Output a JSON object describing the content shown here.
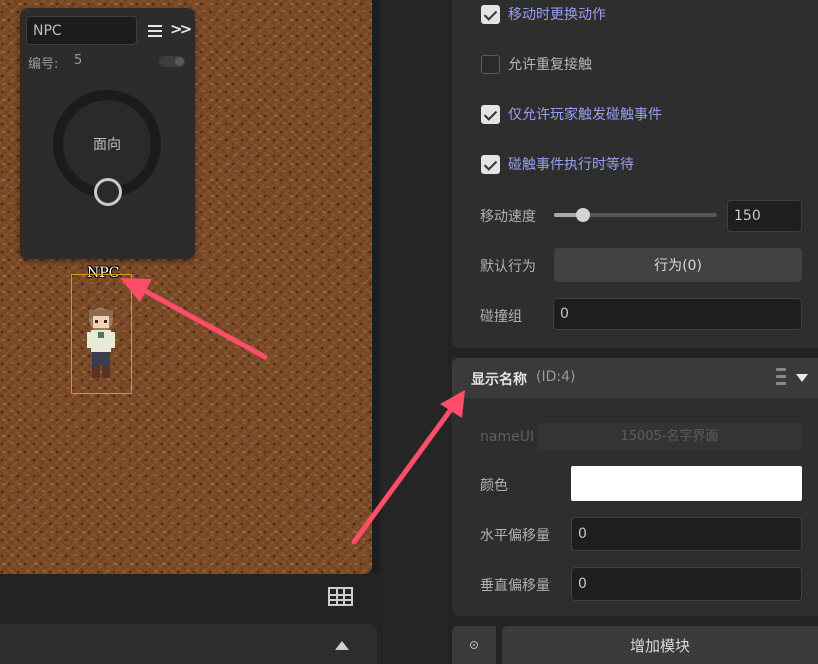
{
  "npc_panel": {
    "name_value": "NPC",
    "id_label": "编号:",
    "id_value": "5",
    "dial_label": "面向"
  },
  "scene": {
    "npc_label": "NPC"
  },
  "properties": {
    "checkboxes": [
      {
        "label": "移动时更换动作",
        "checked": true
      },
      {
        "label": "允许重复接触",
        "checked": false
      },
      {
        "label": "仅允许玩家触发碰触事件",
        "checked": true
      },
      {
        "label": "碰触事件执行时等待",
        "checked": true
      }
    ],
    "move_speed": {
      "label": "移动速度",
      "value": "150",
      "slider_fraction": 0.18
    },
    "default_behavior": {
      "label": "默认行为",
      "button_label": "行为(0)"
    },
    "collision_group": {
      "label": "碰撞组",
      "value": "0"
    }
  },
  "display_name_section": {
    "title": "显示名称",
    "id": "(ID:4)",
    "nameui_label": "nameUI",
    "nameui_value": "15005-名字界面",
    "color_label": "颜色",
    "color_value": "#ffffff",
    "h_offset_label": "水平偏移量",
    "h_offset_value": "0",
    "v_offset_label": "垂直偏移量",
    "v_offset_value": "0"
  },
  "footer": {
    "add_module_label": "增加模块"
  },
  "colors": {
    "annotation_arrow": "#ff4d6a",
    "checked_label": "#9b9ff0",
    "selection_box": "#d39a1c"
  }
}
